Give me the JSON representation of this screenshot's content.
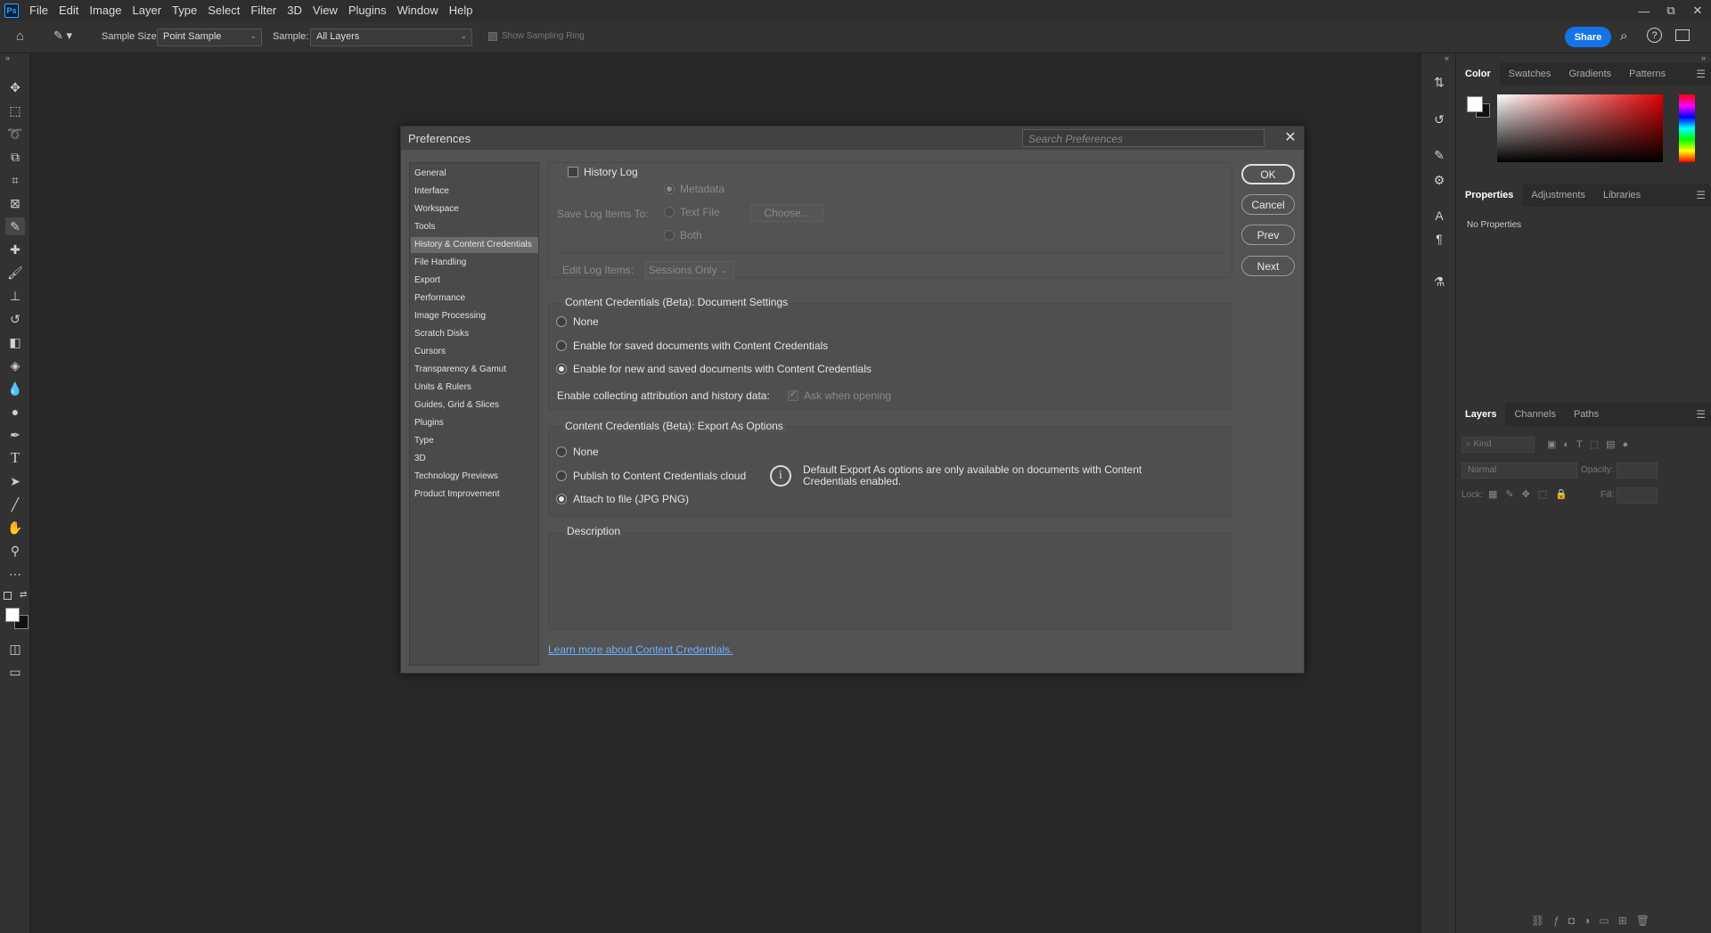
{
  "app": {
    "logo": "Ps"
  },
  "menu": [
    "File",
    "Edit",
    "Image",
    "Layer",
    "Type",
    "Select",
    "Filter",
    "3D",
    "View",
    "Plugins",
    "Window",
    "Help"
  ],
  "window_controls": {
    "minimize": "—",
    "restore": "⧉",
    "close": "✕"
  },
  "options_bar": {
    "sample_size_label": "Sample Size:",
    "sample_size_value": "Point Sample",
    "sample_label": "Sample:",
    "sample_value": "All Layers",
    "show_sampling_ring": "Show Sampling Ring",
    "share": "Share"
  },
  "panels": {
    "color_tabs": [
      "Color",
      "Swatches",
      "Gradients",
      "Patterns"
    ],
    "properties_tabs": [
      "Properties",
      "Adjustments",
      "Libraries"
    ],
    "properties_empty": "No Properties",
    "layers_tabs": [
      "Layers",
      "Channels",
      "Paths"
    ],
    "layers_kind": "Kind",
    "layers_blend": "Normal",
    "layers_opacity_label": "Opacity:",
    "layers_lock_label": "Lock:",
    "layers_fill_label": "Fill:"
  },
  "dialog": {
    "title": "Preferences",
    "search_placeholder": "Search Preferences",
    "nav": [
      "General",
      "Interface",
      "Workspace",
      "Tools",
      "History & Content Credentials",
      "File Handling",
      "Export",
      "Performance",
      "Image Processing",
      "Scratch Disks",
      "Cursors",
      "Transparency & Gamut",
      "Units & Rulers",
      "Guides, Grid & Slices",
      "Plugins",
      "Type",
      "3D",
      "Technology Previews",
      "Product Improvement"
    ],
    "nav_selected_index": 4,
    "history_log": {
      "label": "History Log",
      "save_log_items_to": "Save Log Items To:",
      "metadata": "Metadata",
      "text_file": "Text File",
      "both": "Both",
      "choose": "Choose...",
      "edit_log_items": "Edit Log Items:",
      "edit_log_value": "Sessions Only"
    },
    "doc_settings": {
      "title": "Content Credentials (Beta): Document Settings",
      "none": "None",
      "saved": "Enable for saved documents with Content Credentials",
      "new_and_saved": "Enable for new and saved documents with Content Credentials",
      "attribution": "Enable collecting attribution and history data:",
      "ask_when_opening": "Ask when opening"
    },
    "export_options": {
      "title": "Content Credentials (Beta): Export As Options",
      "none": "None",
      "publish": "Publish to Content Credentials cloud",
      "attach": "Attach to file (JPG PNG)",
      "info": "Default Export As options are only available on documents with Content Credentials enabled."
    },
    "description_title": "Description",
    "learn_more": "Learn more about Content Credentials.",
    "buttons": {
      "ok": "OK",
      "cancel": "Cancel",
      "prev": "Prev",
      "next": "Next"
    }
  }
}
